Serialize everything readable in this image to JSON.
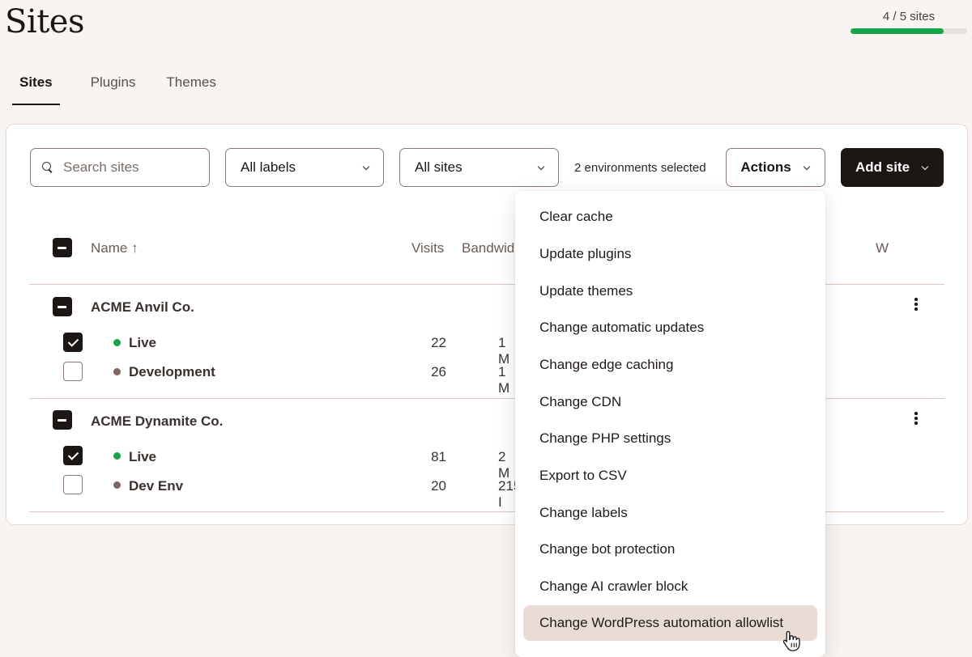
{
  "header": {
    "title": "Sites",
    "quota_text": "4 / 5 sites",
    "quota_used": 4,
    "quota_total": 5
  },
  "tabs": [
    {
      "label": "Sites",
      "active": true
    },
    {
      "label": "Plugins",
      "active": false
    },
    {
      "label": "Themes",
      "active": false
    }
  ],
  "toolbar": {
    "search_placeholder": "Search sites",
    "labels_filter": "All labels",
    "sites_filter": "All sites",
    "selection_status": "2 environments selected",
    "actions_label": "Actions",
    "add_site_label": "Add site"
  },
  "table": {
    "columns": {
      "name": "Name ↑",
      "visits": "Visits",
      "bandwidth": "Bandwid",
      "w": "W"
    },
    "groups": [
      {
        "name": "ACME Anvil Co.",
        "environments": [
          {
            "name": "Live",
            "status": "live",
            "checked": true,
            "visits": "22",
            "bandwidth": "1 M"
          },
          {
            "name": "Development",
            "status": "dev",
            "checked": false,
            "visits": "26",
            "bandwidth": "1 M"
          }
        ]
      },
      {
        "name": "ACME Dynamite Co.",
        "environments": [
          {
            "name": "Live",
            "status": "live",
            "checked": true,
            "visits": "81",
            "bandwidth": "2 M"
          },
          {
            "name": "Dev Env",
            "status": "dev",
            "checked": false,
            "visits": "20",
            "bandwidth": "215 I"
          }
        ]
      }
    ]
  },
  "actions_menu": {
    "items": [
      "Clear cache",
      "Update plugins",
      "Update themes",
      "Change automatic updates",
      "Change edge caching",
      "Change CDN",
      "Change PHP settings",
      "Export to CSV",
      "Change labels",
      "Change bot protection",
      "Change AI crawler block",
      "Change WordPress automation allowlist"
    ],
    "hovered_index": 11
  },
  "colors": {
    "accent_green": "#16a34a",
    "dev_dot": "#7d6660",
    "primary_button": "#1c1614",
    "page_bg": "#f8f4f1",
    "menu_hover": "#e9dcd4"
  }
}
